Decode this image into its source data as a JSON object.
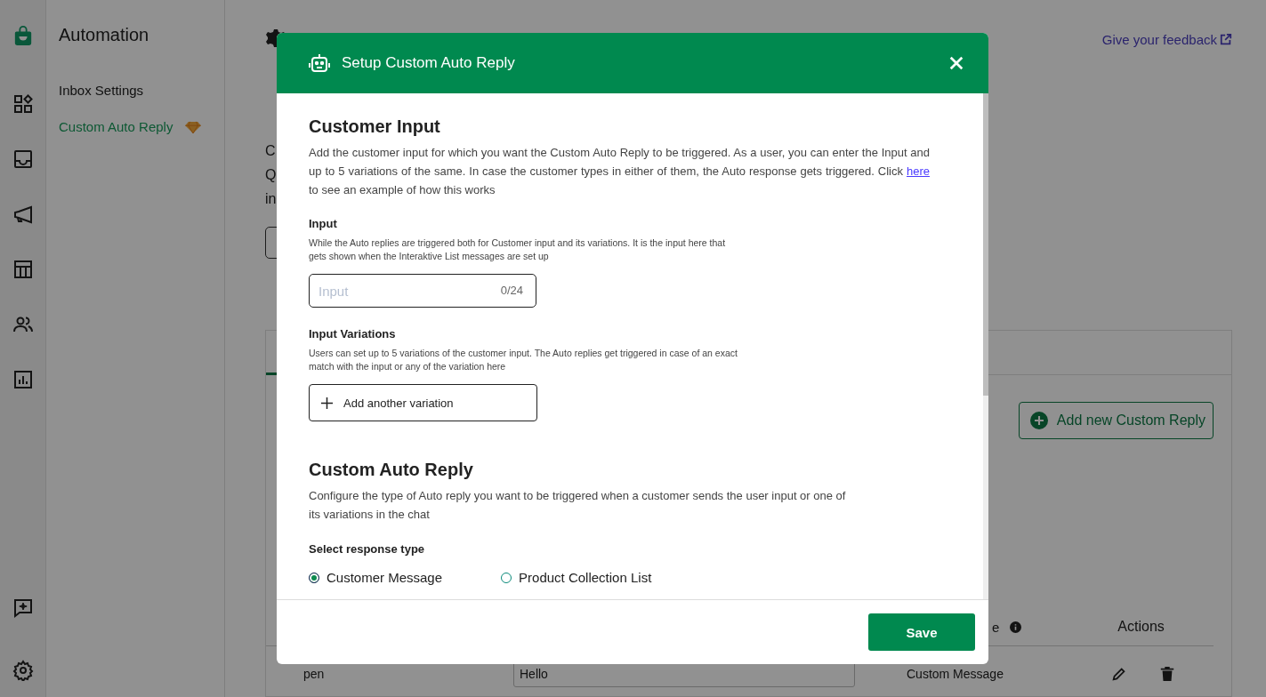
{
  "sidebar": {
    "title": "Automation",
    "items": [
      {
        "label": "Inbox Settings",
        "selected": false,
        "premium": false
      },
      {
        "label": "Custom Auto Reply",
        "selected": true,
        "premium": true
      }
    ]
  },
  "page": {
    "description_lines": [
      "C",
      "Q",
      "in"
    ],
    "feedback_link": "Give your feedback",
    "add_button": "Add new Custom Reply",
    "table": {
      "columns": [
        "e",
        "Actions"
      ],
      "rows": [
        {
          "column_1": "pen",
          "column_2": "Hello",
          "column_3": "Custom Message"
        }
      ]
    }
  },
  "modal": {
    "title": "Setup Custom Auto Reply",
    "sections": [
      {
        "heading": "Customer Input",
        "description": "Add the customer input for which you want the Custom Auto Reply to be triggered. As a user, you can enter the Input and up to 5 variations of the same. In case the customer types in either of them, the Auto response gets triggered. Click ",
        "link": "here",
        "description_after": " to see an example of how this works"
      }
    ],
    "input": {
      "label": "Input",
      "hint": "While the Auto replies are triggered both for Customer input and its variations. It is the input here that gets shown when the Interaktive List messages are set up",
      "placeholder": "Input",
      "counter": "0/24"
    },
    "variations": {
      "label": "Input Variations",
      "hint": "Users can set up to 5 variations of the customer input. The Auto replies get triggered in case of an exact match with the input or any of the variation here",
      "button": "Add another variation"
    },
    "reply": {
      "heading": "Custom Auto Reply",
      "description": "Configure the type of Auto reply you want to be triggered when a customer sends the user input or one of its variations in the chat",
      "label": "Select response type",
      "options": [
        {
          "label": "Customer Message",
          "selected": true
        },
        {
          "label": "Product Collection List",
          "selected": false
        }
      ]
    },
    "save_button": "Save"
  }
}
